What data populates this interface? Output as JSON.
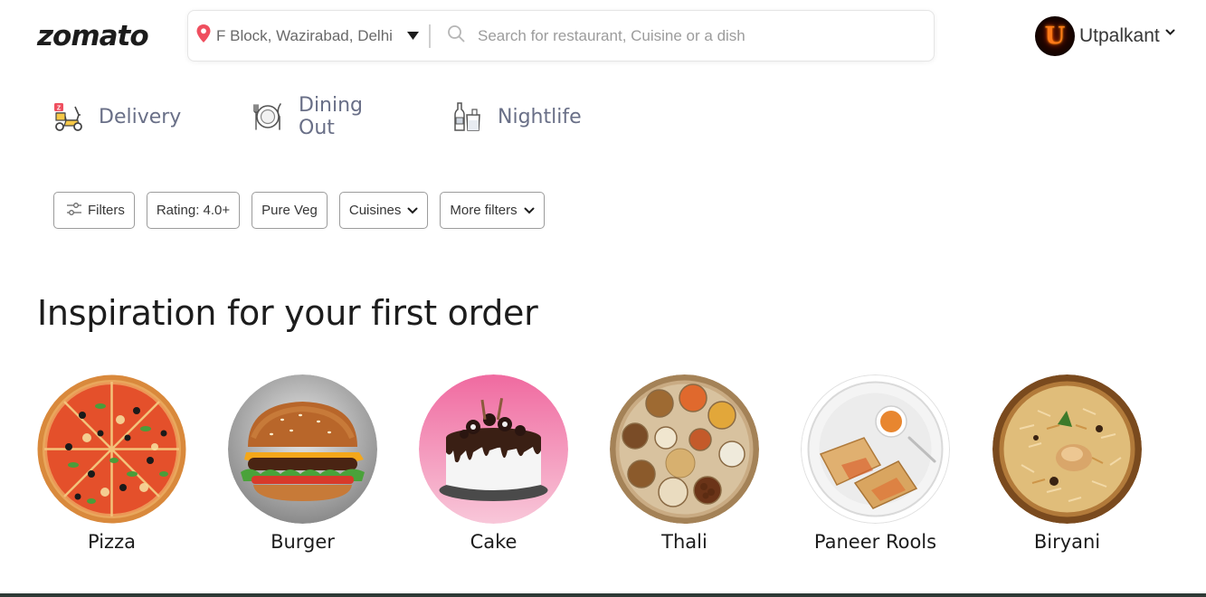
{
  "header": {
    "logo": "zomato",
    "location": {
      "text": "F Block, Wazirabad, Delhi",
      "icon": "location-pin-icon"
    },
    "search": {
      "placeholder": "Search for restaurant, Cuisine or a dish",
      "value": "",
      "icon": "search-icon"
    },
    "user": {
      "avatar_letter": "U",
      "name": "Utpalkant"
    }
  },
  "tabs": [
    {
      "label": "Delivery",
      "icon": "delivery-scooter-icon"
    },
    {
      "label": "Dining Out",
      "icon": "dining-plate-icon"
    },
    {
      "label": "Nightlife",
      "icon": "nightlife-bottle-icon"
    }
  ],
  "filters": [
    {
      "label": "Filters",
      "icon": "sliders-icon"
    },
    {
      "label": "Rating: 4.0+"
    },
    {
      "label": "Pure Veg"
    },
    {
      "label": "Cuisines",
      "icon": "chevron-down-icon"
    },
    {
      "label": "More filters",
      "icon": "chevron-down-icon"
    }
  ],
  "inspiration": {
    "title": "Inspiration for your first order",
    "items": [
      {
        "label": "Pizza"
      },
      {
        "label": "Burger"
      },
      {
        "label": "Cake"
      },
      {
        "label": "Thali"
      },
      {
        "label": "Paneer Rools"
      },
      {
        "label": "Biryani"
      }
    ]
  },
  "colors": {
    "brand_pin": "#ef4f5f",
    "text_dark": "#1c1c1c",
    "tab_text": "#696f87",
    "chip_border": "#9c9c9c"
  }
}
